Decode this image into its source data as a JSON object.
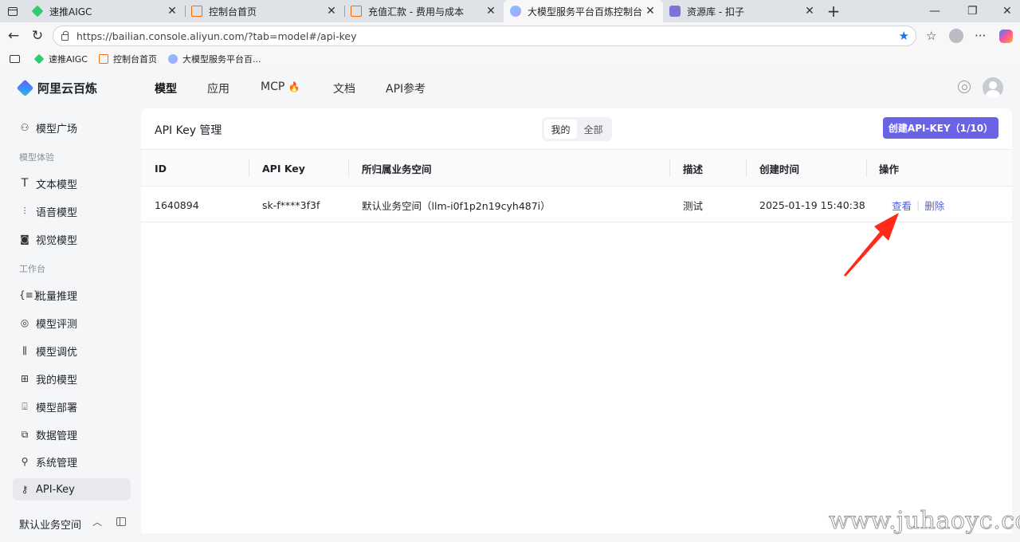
{
  "browser": {
    "tabs": [
      {
        "title": "速推AIGC",
        "icon": "diamond-green"
      },
      {
        "title": "控制台首页",
        "icon": "aliyun-orange"
      },
      {
        "title": "充值汇款 - 费用与成本",
        "icon": "aliyun-orange"
      },
      {
        "title": "大模型服务平台百炼控制台",
        "icon": "bailian-blue",
        "active": true
      },
      {
        "title": "资源库 - 扣子",
        "icon": "coze-purple"
      }
    ],
    "url": "https://bailian.console.aliyun.com/?tab=model#/api-key",
    "bookmarks": [
      {
        "title": "速推AIGC",
        "icon": "diamond-green"
      },
      {
        "title": "控制台首页",
        "icon": "aliyun-orange"
      },
      {
        "title": "大模型服务平台百...",
        "icon": "bailian-blue"
      }
    ]
  },
  "app": {
    "brand": "阿里云百炼",
    "nav": [
      {
        "label": "模型",
        "active": true
      },
      {
        "label": "应用"
      },
      {
        "label": "MCP"
      },
      {
        "label": "文档"
      },
      {
        "label": "API参考"
      }
    ]
  },
  "sidebar": {
    "items": [
      {
        "label": "模型广场",
        "icon": "model-square-icon"
      },
      {
        "label": "文本模型",
        "icon": "text-icon"
      },
      {
        "label": "语音模型",
        "icon": "audio-icon"
      },
      {
        "label": "视觉模型",
        "icon": "camera-icon"
      },
      {
        "label": "批量推理",
        "icon": "batch-icon"
      },
      {
        "label": "模型评测",
        "icon": "compass-icon"
      },
      {
        "label": "模型调优",
        "icon": "tune-icon"
      },
      {
        "label": "我的模型",
        "icon": "grid-icon"
      },
      {
        "label": "模型部署",
        "icon": "deploy-icon"
      },
      {
        "label": "数据管理",
        "icon": "chart-icon"
      },
      {
        "label": "系统管理",
        "icon": "user-icon"
      },
      {
        "label": "API-Key",
        "icon": "key-icon",
        "active": true
      }
    ],
    "groups": [
      "模型体验",
      "工作台"
    ],
    "workspace": "默认业务空间"
  },
  "panel": {
    "title": "API Key 管理",
    "filter": {
      "mine": "我的",
      "all": "全部",
      "selected": "我的"
    },
    "create_button": "创建API-KEY（1/10）",
    "columns": [
      "ID",
      "API Key",
      "所归属业务空间",
      "描述",
      "创建时间",
      "操作"
    ],
    "rows": [
      {
        "id": "1640894",
        "api_key": "sk-f****3f3f",
        "workspace": "默认业务空间（llm-i0f1p2n19cyh487i）",
        "description": "测试",
        "created": "2025-01-19 15:40:38",
        "actions": [
          "查看",
          "删除"
        ]
      }
    ]
  },
  "watermark": "www.juhaoyc.com",
  "colors": {
    "accent": "#6a63e6",
    "link": "#4f5fd9",
    "arrow": "#ff2a1a"
  }
}
